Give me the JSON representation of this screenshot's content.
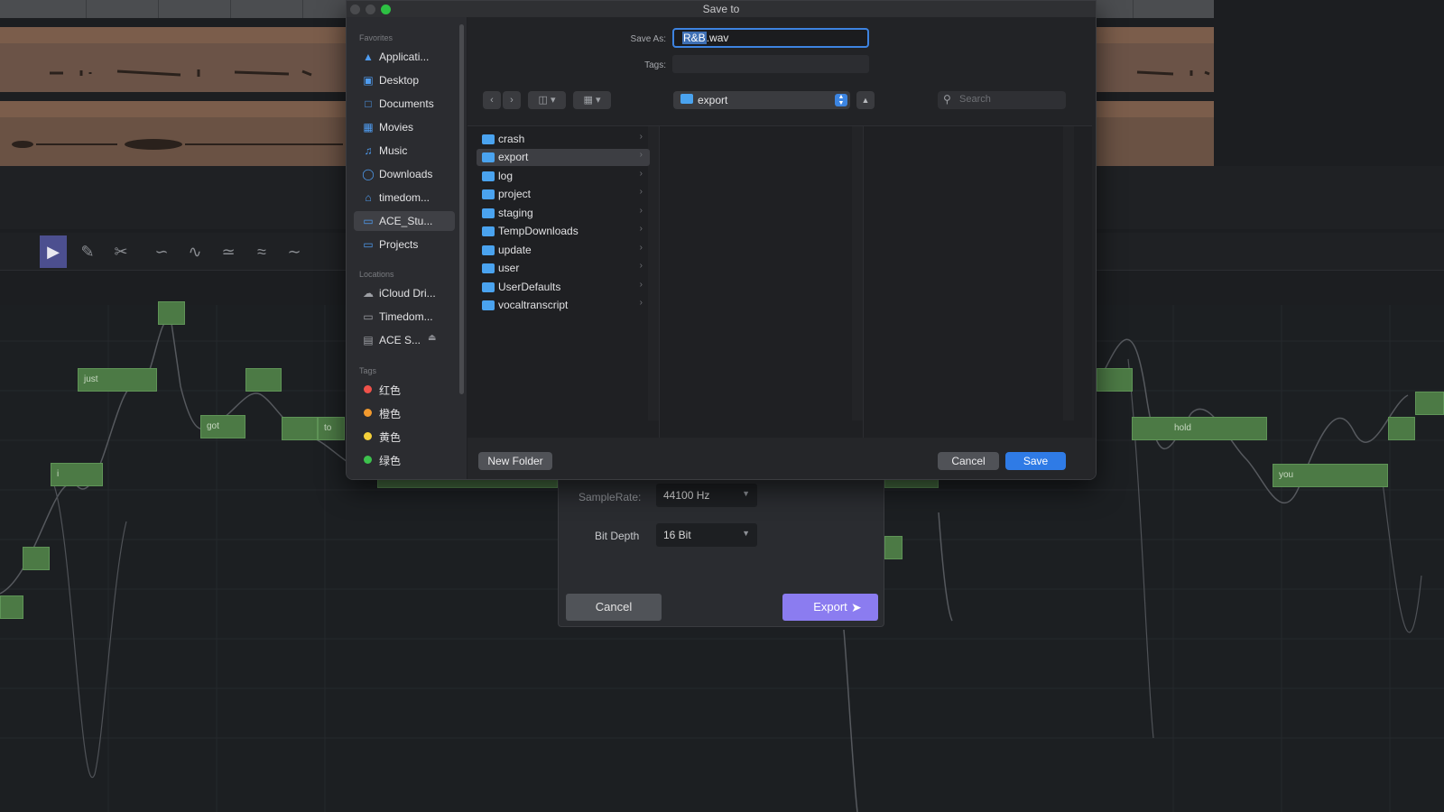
{
  "dialog": {
    "title": "Save to",
    "save_as_label": "Save As:",
    "filename_selected": "R&B",
    "filename_ext": ".wav",
    "tags_label": "Tags:",
    "path_folder": "export",
    "search_placeholder": "Search",
    "new_folder_label": "New Folder",
    "cancel_label": "Cancel",
    "save_label": "Save",
    "accent_color": "#2f7be6"
  },
  "sidebar": {
    "favorites_header": "Favorites",
    "favorites": [
      {
        "label": "Applicati...",
        "icon": "applications-icon"
      },
      {
        "label": "Desktop",
        "icon": "desktop-icon"
      },
      {
        "label": "Documents",
        "icon": "document-icon"
      },
      {
        "label": "Movies",
        "icon": "movies-icon"
      },
      {
        "label": "Music",
        "icon": "music-icon"
      },
      {
        "label": "Downloads",
        "icon": "downloads-icon"
      },
      {
        "label": "timedom...",
        "icon": "home-icon"
      },
      {
        "label": "ACE_Stu...",
        "icon": "folder-icon"
      },
      {
        "label": "Projects",
        "icon": "folder-icon"
      }
    ],
    "locations_header": "Locations",
    "locations": [
      {
        "label": "iCloud Dri...",
        "icon": "cloud-icon"
      },
      {
        "label": "Timedom...",
        "icon": "computer-icon"
      },
      {
        "label": "ACE S...",
        "icon": "drive-icon"
      }
    ],
    "tags_header": "Tags",
    "tags": [
      {
        "label": "红色",
        "color": "#f0524a"
      },
      {
        "label": "橙色",
        "color": "#f29a2e"
      },
      {
        "label": "黄色",
        "color": "#f4d03a"
      },
      {
        "label": "绿色",
        "color": "#3dc24d"
      }
    ]
  },
  "browser": {
    "folders": [
      "crash",
      "export",
      "log",
      "project",
      "staging",
      "TempDownloads",
      "update",
      "user",
      "UserDefaults",
      "vocaltranscript"
    ],
    "selected": "export"
  },
  "export_panel": {
    "sample_rate_label": "SampleRate:",
    "sample_rate_value": "44100 Hz",
    "bit_depth_label": "Bit Depth",
    "bit_depth_value": "16 Bit",
    "cancel_label": "Cancel",
    "export_label": "Export"
  },
  "pianoroll": {
    "notes": [
      "just",
      "got",
      "to",
      "hold",
      "you",
      "i"
    ]
  }
}
